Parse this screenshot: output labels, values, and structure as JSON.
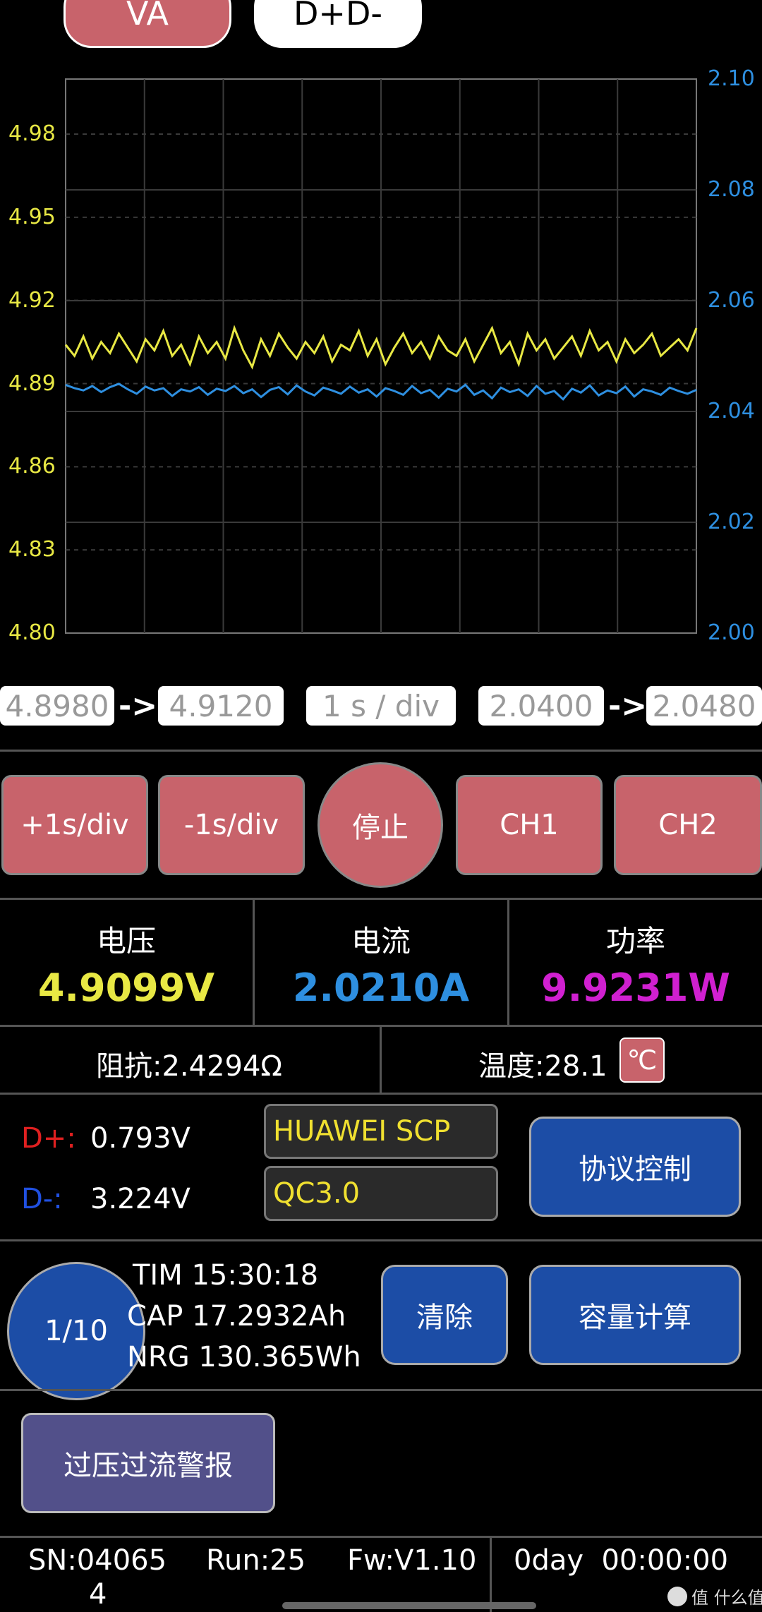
{
  "tabs": {
    "va": "VA",
    "dd": "D+D-"
  },
  "chart_data": {
    "type": "line",
    "left_axis": {
      "ticks": [
        "4.98",
        "4.95",
        "4.92",
        "4.89",
        "4.86",
        "4.83",
        "4.80"
      ],
      "range": [
        4.8,
        4.98
      ]
    },
    "right_axis": {
      "ticks": [
        "2.10",
        "2.08",
        "2.06",
        "2.04",
        "2.02",
        "2.00"
      ],
      "range": [
        2.0,
        2.1
      ]
    },
    "grid": true,
    "series": [
      {
        "axis": "left",
        "color": "#e8e844",
        "values": [
          4.904,
          4.9,
          4.907,
          4.899,
          4.905,
          4.901,
          4.908,
          4.903,
          4.898,
          4.906,
          4.902,
          4.909,
          4.9,
          4.904,
          4.897,
          4.907,
          4.901,
          4.905,
          4.899,
          4.91,
          4.902,
          4.896,
          4.906,
          4.9,
          4.908,
          4.903,
          4.899,
          4.905,
          4.901,
          4.907,
          4.898,
          4.904,
          4.902,
          4.909,
          4.9,
          4.906,
          4.897,
          4.903,
          4.908,
          4.901,
          4.905,
          4.899,
          4.907,
          4.902,
          4.9,
          4.906,
          4.898,
          4.904,
          4.91,
          4.901,
          4.905,
          4.897,
          4.908,
          4.902,
          4.906,
          4.899,
          4.903,
          4.907,
          4.9,
          4.909,
          4.902,
          4.905,
          4.898,
          4.906,
          4.901,
          4.904,
          4.908,
          4.9,
          4.903,
          4.906,
          4.902,
          4.91
        ]
      },
      {
        "axis": "right",
        "color": "#2e8fe0",
        "values": [
          2.0448,
          2.0442,
          2.0438,
          2.0446,
          2.0435,
          2.0444,
          2.045,
          2.044,
          2.0432,
          2.0445,
          2.0438,
          2.0442,
          2.0428,
          2.044,
          2.0436,
          2.0444,
          2.043,
          2.0441,
          2.0437,
          2.0446,
          2.0433,
          2.044,
          2.0426,
          2.0439,
          2.0444,
          2.0431,
          2.0447,
          2.0436,
          2.0429,
          2.0443,
          2.0438,
          2.0432,
          2.0445,
          2.0434,
          2.044,
          2.0427,
          2.0442,
          2.0437,
          2.043,
          2.0446,
          2.0433,
          2.0439,
          2.0425,
          2.0441,
          2.0436,
          2.0448,
          2.043,
          2.0438,
          2.0424,
          2.0443,
          2.0435,
          2.044,
          2.0428,
          2.0446,
          2.0432,
          2.0437,
          2.0422,
          2.0441,
          2.0434,
          2.0447,
          2.0429,
          2.0438,
          2.0433,
          2.0445,
          2.0427,
          2.044,
          2.0436,
          2.043,
          2.0443,
          2.0437,
          2.0432,
          2.0439
        ]
      }
    ]
  },
  "range": {
    "ch1_min": "4.8980",
    "ch1_max": "4.9120",
    "timebase": "1 s / div",
    "ch2_min": "2.0400",
    "ch2_max": "2.0480",
    "arrow": "->"
  },
  "buttons": {
    "plus": "+1s/div",
    "minus": "-1s/div",
    "stop": "停止",
    "ch1": "CH1",
    "ch2": "CH2"
  },
  "measure": {
    "voltage_label": "电压",
    "voltage": "4.9099V",
    "current_label": "电流",
    "current": "2.0210A",
    "power_label": "功率",
    "power": "9.9231W"
  },
  "impedance": "阻抗:2.4294Ω",
  "temperature": "温度:28.1",
  "temp_unit": "℃",
  "dpdm": {
    "dp_label": "D+:",
    "dp_value": "0.793V",
    "dm_label": "D-:",
    "dm_value": "3.224V"
  },
  "protocols": [
    "HUAWEI SCP",
    "QC3.0"
  ],
  "protocol_control": "协议控制",
  "record": {
    "index": "1/10",
    "tim": "TIM 15:30:18",
    "cap": "CAP 17.2932Ah",
    "nrg": "NRG 130.365Wh",
    "clear": "清除",
    "capacity_calc": "容量计算"
  },
  "alarm": "过压过流警报",
  "footer": {
    "sn": "SN:04065",
    "sn2": "4",
    "run": "Run:25",
    "fw": "Fw:V1.10",
    "uptime": "0day  00:00:00"
  },
  "watermark": "值 什么值得买",
  "colors": {
    "yellow": "#e8e844",
    "blue": "#2e8fe0",
    "magenta": "#d020d0",
    "button": "#c8636b",
    "blue_button": "#1c4da6"
  }
}
